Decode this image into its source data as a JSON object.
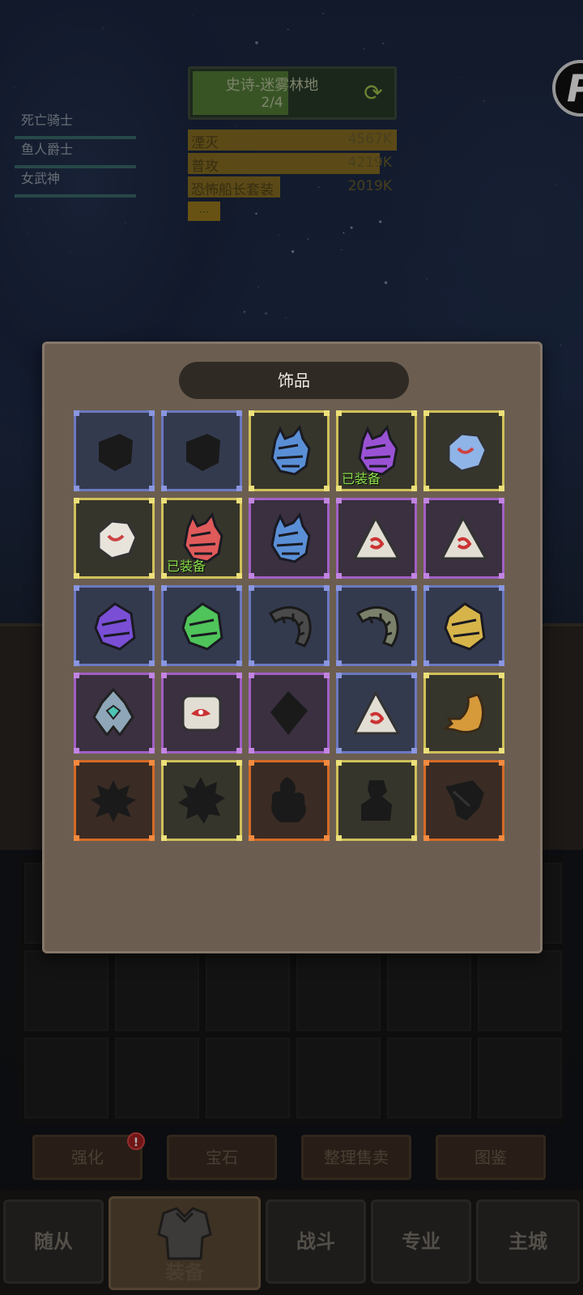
{
  "stage": {
    "title": "史诗-迷雾林地",
    "count": "2/4",
    "progress": 0.47
  },
  "party": [
    "死亡骑士",
    "鱼人爵士",
    "女武神"
  ],
  "damage": [
    {
      "name": "湮灭",
      "value": "4567K",
      "fill": 1.0
    },
    {
      "name": "普攻",
      "value": "4219K",
      "fill": 0.92
    },
    {
      "name": "恐怖船长套装",
      "value": "2019K",
      "fill": 0.44
    }
  ],
  "damage_more": "...",
  "modal": {
    "title": "饰品",
    "equipped_label": "已装备",
    "items": [
      {
        "rarity": "blue",
        "icon": "empty-gem-silhouette-icon",
        "shape": "gem",
        "color": "#222",
        "equipped": false
      },
      {
        "rarity": "blue",
        "icon": "empty-gem-silhouette-icon",
        "shape": "gem",
        "color": "#222",
        "equipped": false
      },
      {
        "rarity": "yellow",
        "icon": "blue-horned-gem-icon",
        "shape": "horned",
        "color": "#5a8fd6",
        "equipped": false
      },
      {
        "rarity": "yellow",
        "icon": "purple-horned-gem-icon",
        "shape": "horned",
        "color": "#9a52d4",
        "equipped": true
      },
      {
        "rarity": "yellow",
        "icon": "blue-rune-stone-icon",
        "shape": "round",
        "color": "#8fb4e8",
        "equipped": false
      },
      {
        "rarity": "yellow",
        "icon": "red-mask-stone-icon",
        "shape": "round",
        "color": "#e8e4dc",
        "equipped": false
      },
      {
        "rarity": "yellow",
        "icon": "red-horned-gem-icon",
        "shape": "horned",
        "color": "#e05a5a",
        "equipped": true
      },
      {
        "rarity": "purple",
        "icon": "blue-horned-gem-icon",
        "shape": "horned",
        "color": "#5a8fd6",
        "equipped": false
      },
      {
        "rarity": "purple",
        "icon": "red-triangle-rune-icon",
        "shape": "triangle",
        "color": "#e2ded4",
        "equipped": false
      },
      {
        "rarity": "purple",
        "icon": "green-triangle-rune-icon",
        "shape": "triangle",
        "color": "#e2ded4",
        "equipped": false
      },
      {
        "rarity": "blue",
        "icon": "purple-crystal-icon",
        "shape": "crystal",
        "color": "#7a4fd6",
        "equipped": false
      },
      {
        "rarity": "blue",
        "icon": "green-crystal-icon",
        "shape": "crystal",
        "color": "#4fc45a",
        "equipped": false
      },
      {
        "rarity": "blue",
        "icon": "dark-horn-icon",
        "shape": "horn",
        "color": "#4a4a4a",
        "equipped": false
      },
      {
        "rarity": "blue",
        "icon": "olive-horn-icon",
        "shape": "horn",
        "color": "#7a806a",
        "equipped": false
      },
      {
        "rarity": "blue",
        "icon": "gold-crystal-icon",
        "shape": "crystal",
        "color": "#d6b44a",
        "equipped": false
      },
      {
        "rarity": "purple",
        "icon": "jade-amulet-icon",
        "shape": "amulet",
        "color": "#8fa6b8",
        "equipped": false
      },
      {
        "rarity": "purple",
        "icon": "red-eye-stone-icon",
        "shape": "square",
        "color": "#e2ded4",
        "equipped": false
      },
      {
        "rarity": "purple",
        "icon": "empty-diamond-silhouette-icon",
        "shape": "diamond",
        "color": "#222",
        "equipped": false
      },
      {
        "rarity": "blue",
        "icon": "cyan-triangle-rune-icon",
        "shape": "triangle",
        "color": "#e2ded4",
        "equipped": false
      },
      {
        "rarity": "yellow",
        "icon": "golden-claw-icon",
        "shape": "claw",
        "color": "#d69a3a",
        "equipped": false
      },
      {
        "rarity": "orange",
        "icon": "empty-splat-silhouette-icon",
        "shape": "splat",
        "color": "#222",
        "equipped": false
      },
      {
        "rarity": "yellow",
        "icon": "empty-spiky-silhouette-icon",
        "shape": "spiky",
        "color": "#222",
        "equipped": false
      },
      {
        "rarity": "orange",
        "icon": "empty-flame-silhouette-icon",
        "shape": "flame",
        "color": "#222",
        "equipped": false
      },
      {
        "rarity": "yellow",
        "icon": "empty-figure-silhouette-icon",
        "shape": "figure",
        "color": "#222",
        "equipped": false
      },
      {
        "rarity": "orange",
        "icon": "empty-shard-silhouette-icon",
        "shape": "shard",
        "color": "#222",
        "equipped": false
      }
    ]
  },
  "actions": [
    "强化",
    "宝石",
    "整理售卖",
    "图鉴"
  ],
  "alert_mark": "!",
  "tabs": [
    "随从",
    "装备",
    "战斗",
    "专业",
    "主城"
  ],
  "active_tab": 1,
  "colors": {
    "blue": "#6b78c0",
    "yellow": "#cfc05a",
    "purple": "#a15fc4",
    "orange": "#d56a26",
    "equipped_text": "#8be04a"
  }
}
